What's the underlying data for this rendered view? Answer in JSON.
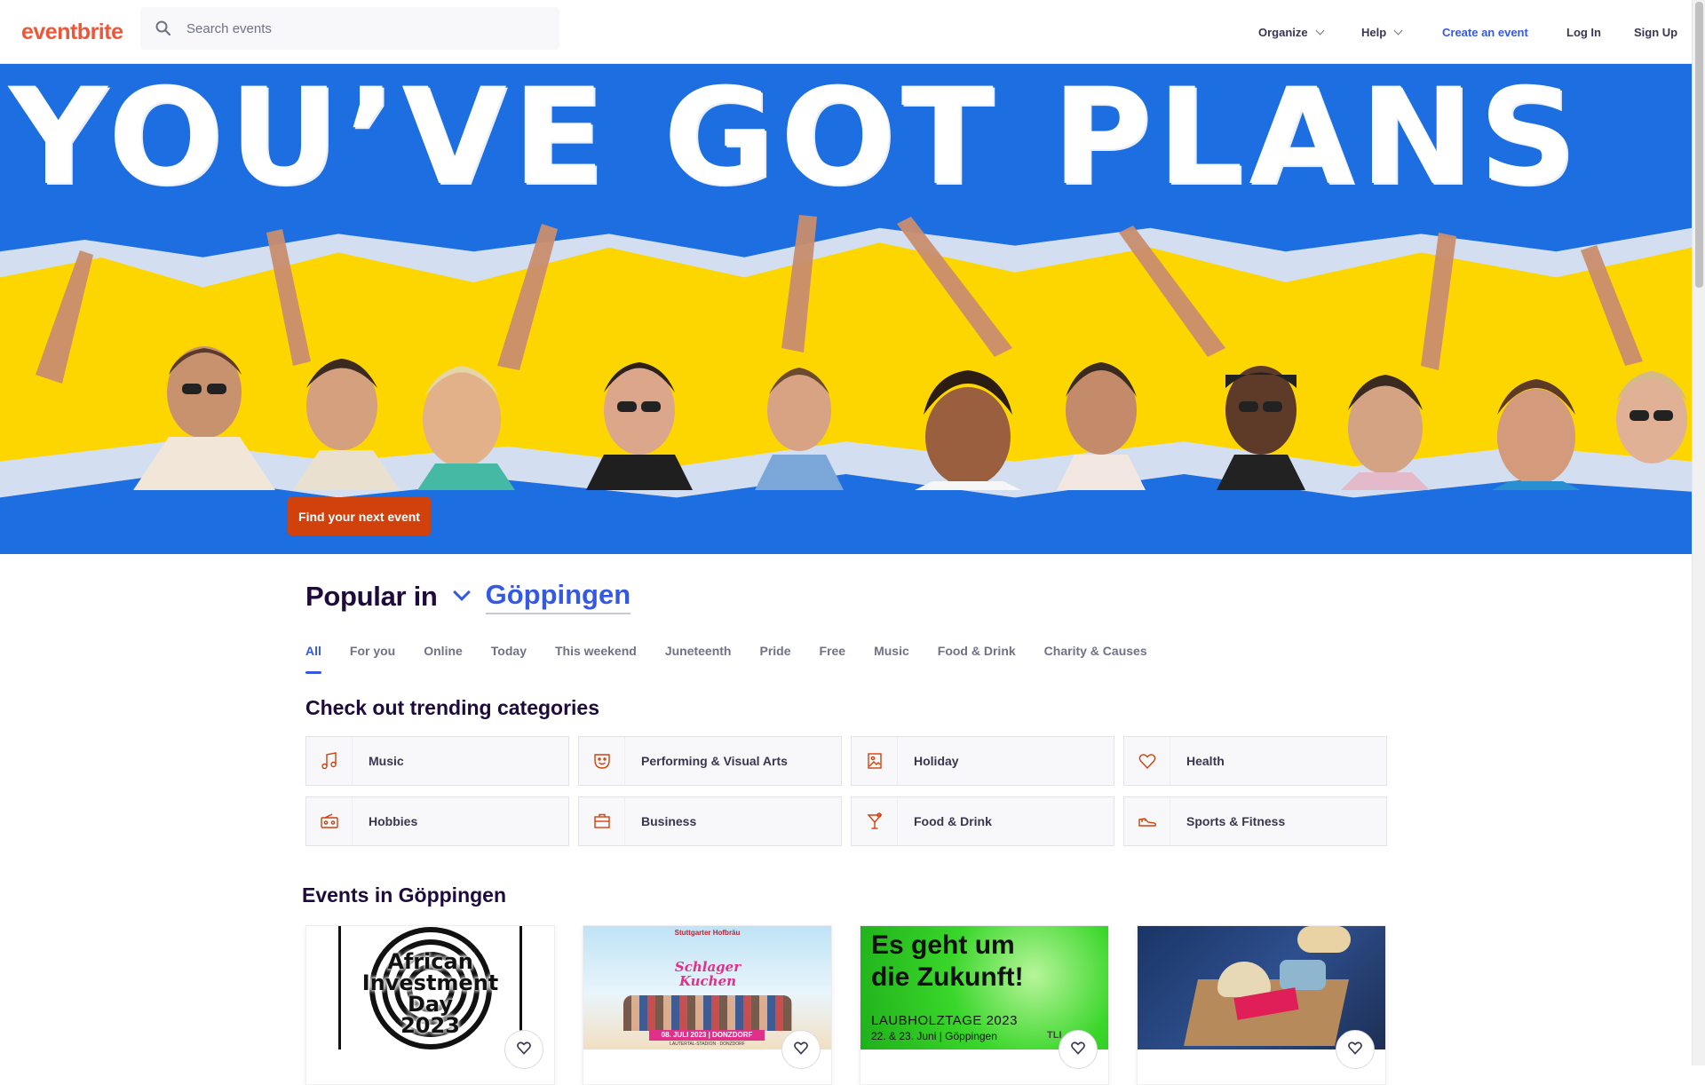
{
  "header": {
    "logo": "eventbrite",
    "search_placeholder": "Search events",
    "nav": {
      "organize": "Organize",
      "help": "Help",
      "create": "Create an event",
      "login": "Log In",
      "signup": "Sign Up"
    }
  },
  "hero": {
    "headline": "YOU’VE GOT PLANS",
    "cta": "Find your next event"
  },
  "popular": {
    "label": "Popular in",
    "location": "Göppingen"
  },
  "tabs": [
    "All",
    "For you",
    "Online",
    "Today",
    "This weekend",
    "Juneteenth",
    "Pride",
    "Free",
    "Music",
    "Food & Drink",
    "Charity & Causes"
  ],
  "trending": {
    "title": "Check out trending categories",
    "categories": [
      {
        "label": "Music",
        "icon": "music-note-icon"
      },
      {
        "label": "Performing & Visual Arts",
        "icon": "theater-mask-icon"
      },
      {
        "label": "Holiday",
        "icon": "image-frame-icon"
      },
      {
        "label": "Health",
        "icon": "heart-icon"
      },
      {
        "label": "Hobbies",
        "icon": "radio-icon"
      },
      {
        "label": "Business",
        "icon": "briefcase-icon"
      },
      {
        "label": "Food & Drink",
        "icon": "cocktail-icon"
      },
      {
        "label": "Sports & Fitness",
        "icon": "sneaker-icon"
      }
    ]
  },
  "events": {
    "title": "Events in Göppingen",
    "cards": [
      {
        "image_text": [
          "African",
          "Investment",
          "Day",
          "2023"
        ]
      },
      {
        "image_text": [
          "Stuttgarter Hofbräu",
          "Schlager Kuchen",
          "08. JULI 2023 | DONZDORF",
          "LAUTERTAL-STADION · DONZDORF"
        ]
      },
      {
        "image_text": [
          "Es geht um",
          "die Zukunft!",
          "LAUBHOLZTAGE 2023",
          "22. & 23. Juni | Göppingen",
          "TLI"
        ]
      },
      {
        "image_text": []
      }
    ]
  },
  "colors": {
    "brand": "#f05537",
    "link": "#3659e3",
    "cta": "#d1410c",
    "hero_blue": "#1d6ee0",
    "hero_yellow": "#fdd600"
  }
}
